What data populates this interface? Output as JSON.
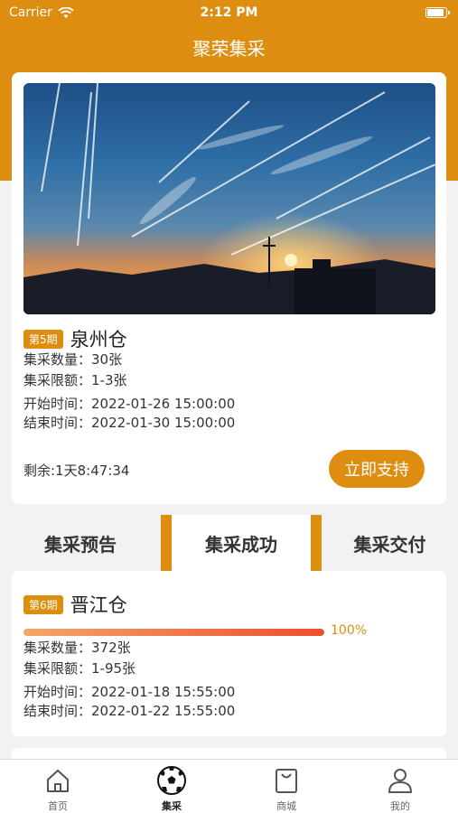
{
  "status_bar": {
    "carrier": "Carrier",
    "time": "2:12 PM"
  },
  "nav": {
    "title": "聚荣集采"
  },
  "hero": {
    "image_alt": "sunset sky with contrails",
    "period": "第5期",
    "warehouse": "泉州仓",
    "quantity": "集采数量：30张",
    "limit": "集采限额：1-3张",
    "start": "开始时间：2022-01-26 15:00:00",
    "end": "结束时间：2022-01-30 15:00:00",
    "remaining": "剩余:1天8:47:34",
    "button": "立即支持"
  },
  "tabs": [
    {
      "label": "集采预告"
    },
    {
      "label": "集采成功"
    },
    {
      "label": "集采交付"
    }
  ],
  "list": [
    {
      "period": "第6期",
      "warehouse": "晋江仓",
      "progress": 1.0,
      "progress_label": "100%",
      "quantity": "集采数量：372张",
      "limit": "集采限额：1-95张",
      "start": "开始时间：2022-01-18 15:55:00",
      "end": "结束时间：2022-01-22 15:55:00"
    }
  ],
  "tabbar": [
    {
      "label": "首页",
      "icon": "home-icon"
    },
    {
      "label": "集采",
      "icon": "soccer-ball-icon"
    },
    {
      "label": "商城",
      "icon": "shopping-bag-icon"
    },
    {
      "label": "我的",
      "icon": "user-icon"
    }
  ],
  "colors": {
    "accent": "#dd8e10",
    "progress_start": "#f3a766",
    "progress_end": "#ee4e2a"
  }
}
